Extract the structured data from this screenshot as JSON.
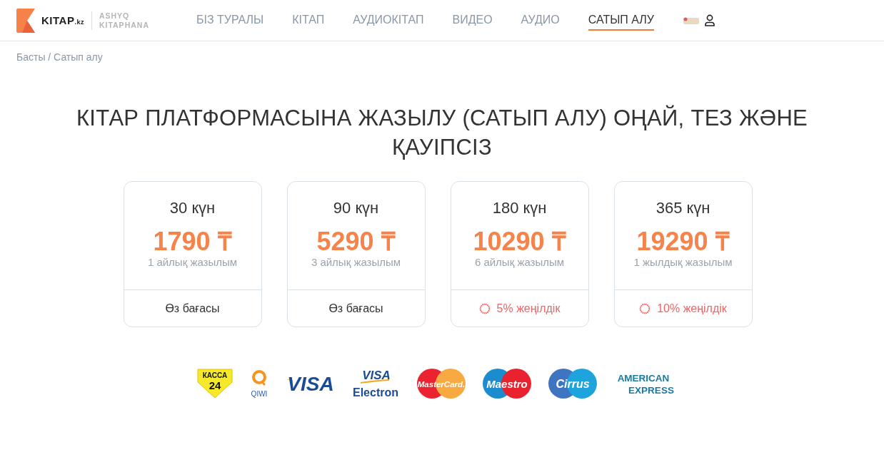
{
  "header": {
    "logo": {
      "brand": "KITAP",
      "suffix": ".kz",
      "tagline_1": "ASHYQ",
      "tagline_2": "KITAPHANA"
    },
    "nav": [
      {
        "label": "БІЗ ТУРАЛЫ",
        "selected": false
      },
      {
        "label": "КІТАП",
        "selected": false
      },
      {
        "label": "АУДИОКІТАП",
        "selected": false
      },
      {
        "label": "ВИДЕО",
        "selected": false
      },
      {
        "label": "АУДИО",
        "selected": false
      },
      {
        "label": "САТЫП АЛУ",
        "selected": true
      }
    ]
  },
  "breadcrumb": "Басты / Сатып алу",
  "title": "КІТАР ПЛАТФОРМАСЫНА ЖАЗЫЛУ (САТЫП АЛУ) ОҢАЙ, ТЕЗ ЖӘНЕ ҚАУІПСІЗ",
  "plans": [
    {
      "duration": "30 күн",
      "price": "1790 ₸",
      "subtitle": "1 айлық жазылым",
      "footer": "Өз бағасы",
      "kind": "plain"
    },
    {
      "duration": "90 күн",
      "price": "5290 ₸",
      "subtitle": "3 айлық жазылым",
      "footer": "Өз бағасы",
      "kind": "plain"
    },
    {
      "duration": "180 күн",
      "price": "10290 ₸",
      "subtitle": "6 айлық жазылым",
      "footer": "5% жеңілдік",
      "kind": "discount"
    },
    {
      "duration": "365 күн",
      "price": "19290 ₸",
      "subtitle": "1 жылдық жазылым",
      "footer": "10% жеңілдік",
      "kind": "discount"
    }
  ],
  "payment_methods": [
    {
      "kind": "kassa",
      "texts": [
        "КАССА",
        "24"
      ]
    },
    {
      "kind": "qiwi",
      "texts": [
        "QIWI"
      ]
    },
    {
      "kind": "visa",
      "texts": [
        "VISA"
      ]
    },
    {
      "kind": "visa-electron",
      "texts": [
        "VISA",
        "Electron"
      ]
    },
    {
      "kind": "mastercard",
      "texts": [
        "MasterCard."
      ]
    },
    {
      "kind": "maestro",
      "texts": [
        "Maestro"
      ]
    },
    {
      "kind": "cirrus",
      "texts": [
        "Cirrus"
      ]
    },
    {
      "kind": "amex",
      "texts": [
        "AMERICAN",
        "EXPRESS"
      ]
    }
  ]
}
